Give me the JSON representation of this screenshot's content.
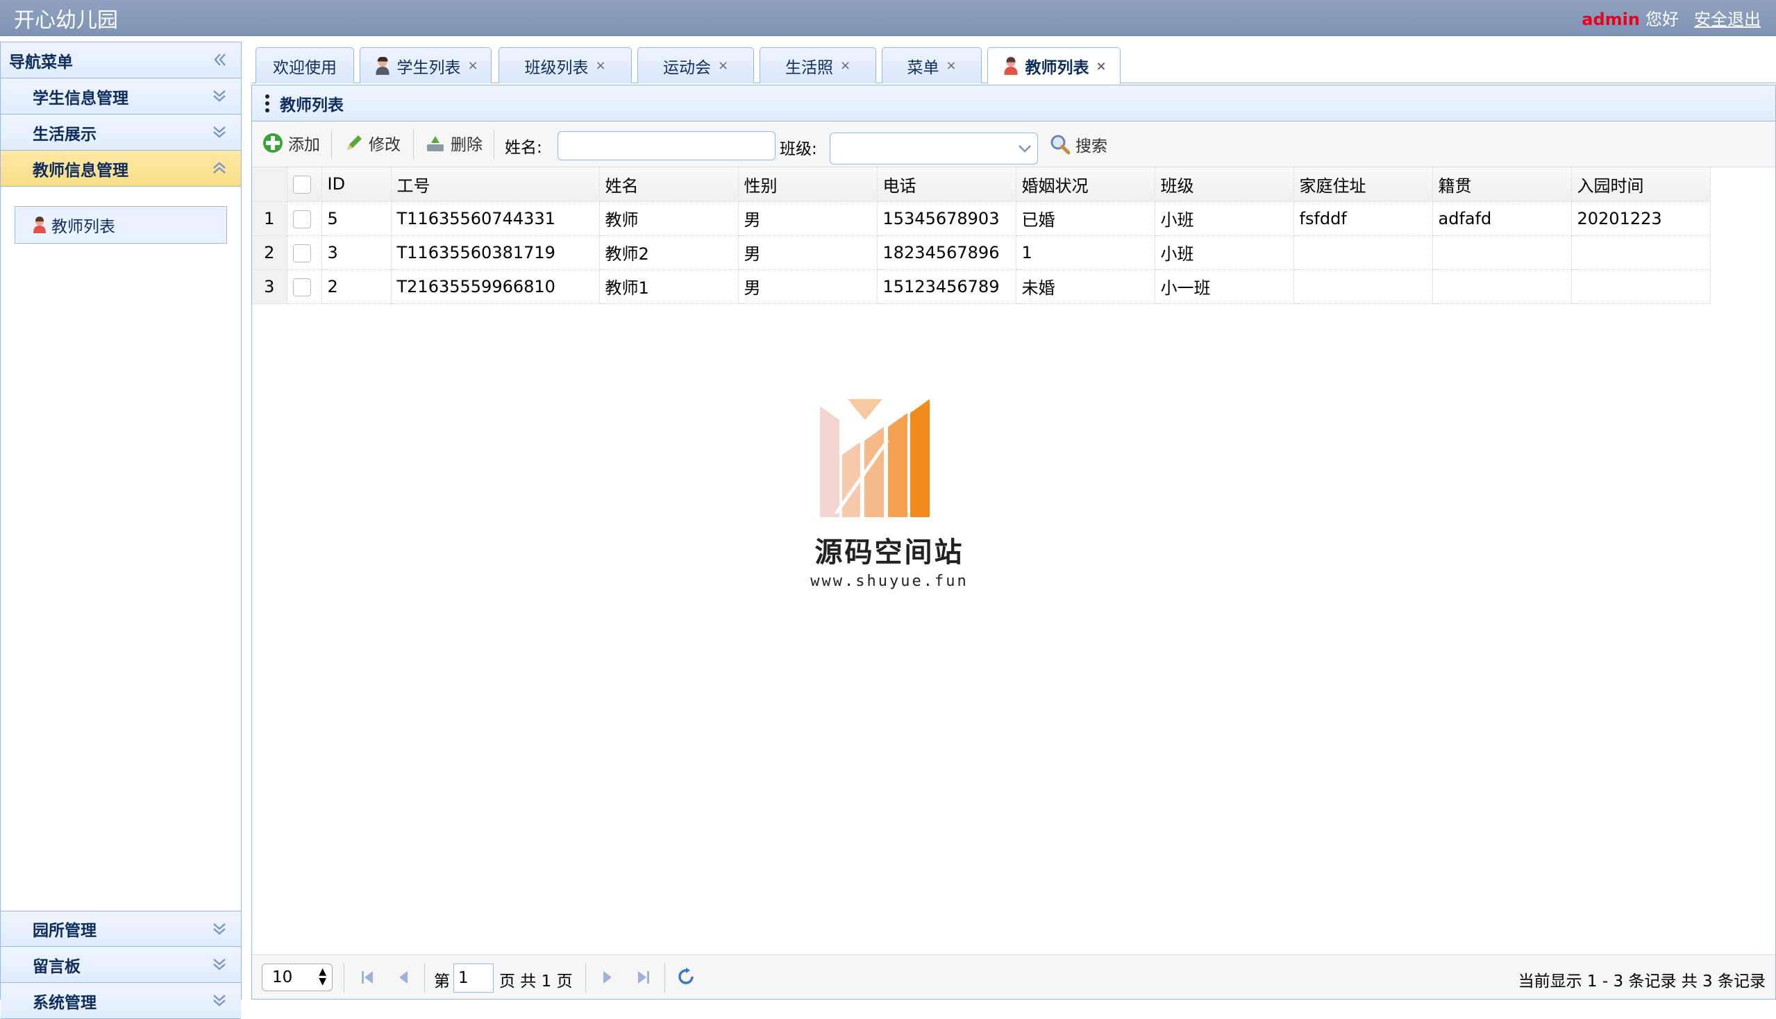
{
  "header": {
    "app_title": "开心幼儿园",
    "user_name": "admin",
    "greeting": "您好",
    "logout": "安全退出"
  },
  "nav": {
    "title": "导航菜单",
    "sections": [
      {
        "label": "学生信息管理"
      },
      {
        "label": "生活展示"
      },
      {
        "label": "教师信息管理",
        "active": true,
        "items": [
          {
            "label": "教师列表"
          }
        ]
      }
    ],
    "bottom_sections": [
      {
        "label": "园所管理"
      },
      {
        "label": "留言板"
      },
      {
        "label": "系统管理"
      }
    ]
  },
  "tabs": [
    {
      "label": "欢迎使用",
      "closable": false,
      "icon": "none"
    },
    {
      "label": "学生列表",
      "closable": true,
      "icon": "student-avatar-icon"
    },
    {
      "label": "班级列表",
      "closable": true,
      "icon": "none"
    },
    {
      "label": "运动会",
      "closable": true,
      "icon": "none"
    },
    {
      "label": "生活照",
      "closable": true,
      "icon": "none"
    },
    {
      "label": "菜单",
      "closable": true,
      "icon": "none"
    },
    {
      "label": "教师列表",
      "closable": true,
      "icon": "teacher-avatar-icon",
      "active": true
    }
  ],
  "tab_close_glyph": "×",
  "panel": {
    "title": "教师列表"
  },
  "toolbar": {
    "add": "添加",
    "edit": "修改",
    "delete": "删除",
    "name_label": "姓名:",
    "name_value": "",
    "class_label": "班级:",
    "class_value": "",
    "search": "搜索"
  },
  "table": {
    "columns": [
      "ID",
      "工号",
      "姓名",
      "性别",
      "电话",
      "婚姻状况",
      "班级",
      "家庭住址",
      "籍贯",
      "入园时间"
    ],
    "rows": [
      {
        "rn": "1",
        "cells": [
          "5",
          "T11635560744331",
          "教师",
          "男",
          "15345678903",
          "已婚",
          "小班",
          "fsfddf",
          "adfafd",
          "20201223"
        ]
      },
      {
        "rn": "2",
        "cells": [
          "3",
          "T11635560381719",
          "教师2",
          "男",
          "18234567896",
          "1",
          "小班",
          "",
          "",
          ""
        ]
      },
      {
        "rn": "3",
        "cells": [
          "2",
          "T21635559966810",
          "教师1",
          "男",
          "15123456789",
          "未婚",
          "小一班",
          "",
          "",
          ""
        ]
      }
    ]
  },
  "watermark": {
    "title": "源码空间站",
    "url": "www.shuyue.fun"
  },
  "pager": {
    "page_size": "10",
    "page_prefix": "第",
    "page_value": "1",
    "page_suffix": "页 共 1 页",
    "info": "当前显示 1 - 3 条记录 共 3 条记录"
  },
  "colors": {
    "header_bg": "#8498b8",
    "border": "#95b8e7",
    "active_section": "#fadf8e",
    "user_name": "#e8001c"
  }
}
